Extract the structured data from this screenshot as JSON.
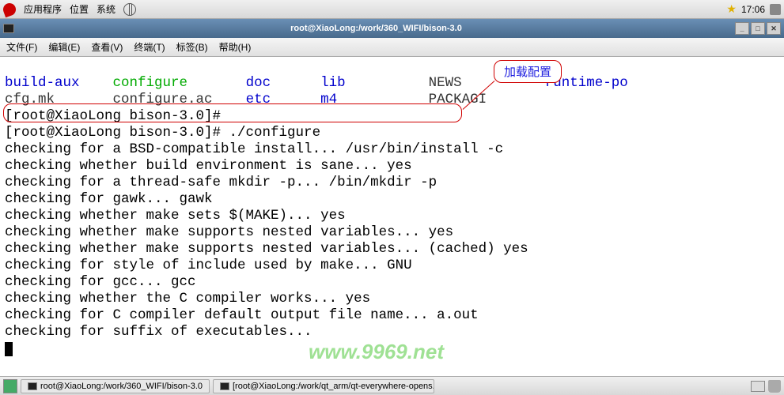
{
  "top_panel": {
    "menu1": "应用程序",
    "menu2": "位置",
    "menu3": "系统",
    "clock": "17:06"
  },
  "titlebar": {
    "title": "root@XiaoLong:/work/360_WIFI/bison-3.0"
  },
  "menubar": {
    "file": "文件(F)",
    "edit": "编辑(E)",
    "view": "查看(V)",
    "terminal": "终端(T)",
    "tabs": "标签(B)",
    "help": "帮助(H)"
  },
  "ls": {
    "c0r0": "build-aux",
    "c1r0": "configure",
    "c2r0": "doc",
    "c3r0": "lib",
    "c4r0": "NEWS",
    "c5r0": "runtime-po",
    "c0r1": "cfg.mk",
    "c1r1": "configure.ac",
    "c2r1": "etc",
    "c3r1": "m4",
    "c4r1": "PACKAGI",
    "c5r1": ""
  },
  "prompt1": "[root@XiaoLong bison-3.0]#",
  "prompt2": "[root@XiaoLong bison-3.0]# ",
  "cmd": "./configure",
  "lines": {
    "l1": "checking for a BSD-compatible install... /usr/bin/install -c",
    "l2": "checking whether build environment is sane... yes",
    "l3": "checking for a thread-safe mkdir -p... /bin/mkdir -p",
    "l4": "checking for gawk... gawk",
    "l5": "checking whether make sets $(MAKE)... yes",
    "l6": "checking whether make supports nested variables... yes",
    "l7": "checking whether make supports nested variables... (cached) yes",
    "l8": "checking for style of include used by make... GNU",
    "l9": "checking for gcc... gcc",
    "l10": "checking whether the C compiler works... yes",
    "l11": "checking for C compiler default output file name... a.out",
    "l12": "checking for suffix of executables..."
  },
  "callout": {
    "label": "加载配置"
  },
  "watermark": "www.9969.net",
  "taskbar": {
    "item1": "root@XiaoLong:/work/360_WIFI/bison-3.0",
    "item2": "[root@XiaoLong:/work/qt_arm/qt-everywhere-opens..."
  }
}
